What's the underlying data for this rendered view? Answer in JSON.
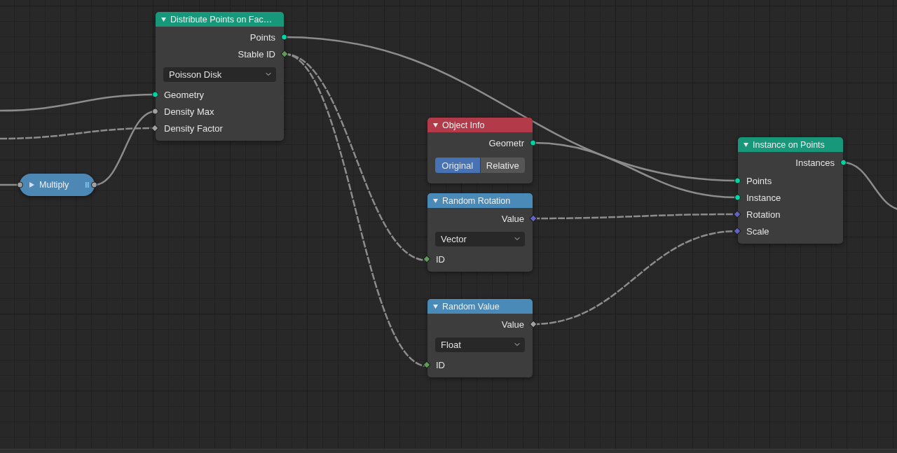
{
  "nodes": [
    {
      "kind": "node",
      "title": "Distribute Points on Fac…",
      "color": "#17987a",
      "rows": [
        {
          "kind": "output",
          "label": "Points",
          "color": "#00d6a3",
          "field": false
        },
        {
          "kind": "output",
          "label": "Stable ID",
          "color": "#5d9b58",
          "field": true
        },
        {
          "kind": "dropdown",
          "value": "Poisson Disk"
        },
        {
          "kind": "input",
          "label": "Geometry",
          "color": "#00d6a3",
          "field": false
        },
        {
          "kind": "input",
          "label": "Density Max",
          "color": "#a1a1a1",
          "field": false
        },
        {
          "kind": "input",
          "label": "Density Factor",
          "color": "#a1a1a1",
          "field": true
        }
      ]
    },
    {
      "kind": "collapsed",
      "title": "Multiply",
      "color": "#4d88b5"
    },
    {
      "kind": "node",
      "title": "Object Info",
      "color": "#b33a48",
      "rows": [
        {
          "kind": "output",
          "label": "Geometr",
          "color": "#00d6a3",
          "field": false
        },
        {
          "kind": "toggle",
          "options": [
            {
              "label": "Original",
              "selected": true
            },
            {
              "label": "Relative",
              "selected": false
            }
          ]
        }
      ]
    },
    {
      "kind": "node",
      "title": "Random Rotation",
      "color": "#4a8ab8",
      "rows": [
        {
          "kind": "output",
          "label": "Value",
          "color": "#6363c7",
          "field": true
        },
        {
          "kind": "dropdown",
          "value": "Vector"
        },
        {
          "kind": "input",
          "label": "ID",
          "color": "#5d9b58",
          "field": true
        }
      ]
    },
    {
      "kind": "node",
      "title": "Random Value",
      "color": "#4a8ab8",
      "rows": [
        {
          "kind": "output",
          "label": "Value",
          "color": "#a1a1a1",
          "field": true
        },
        {
          "kind": "dropdown",
          "value": "Float"
        },
        {
          "kind": "input",
          "label": "ID",
          "color": "#5d9b58",
          "field": true
        }
      ]
    },
    {
      "kind": "node",
      "title": "Instance on Points",
      "color": "#17987a",
      "rows": [
        {
          "kind": "output",
          "label": "Instances",
          "color": "#00d6a3",
          "field": false
        },
        {
          "kind": "input",
          "label": "Points",
          "color": "#00d6a3",
          "field": false
        },
        {
          "kind": "input",
          "label": "Instance",
          "color": "#00d6a3",
          "field": false
        },
        {
          "kind": "input",
          "label": "Rotation",
          "color": "#6363c7",
          "field": true
        },
        {
          "kind": "input",
          "label": "Scale",
          "color": "#6363c7",
          "field": true
        }
      ]
    }
  ]
}
